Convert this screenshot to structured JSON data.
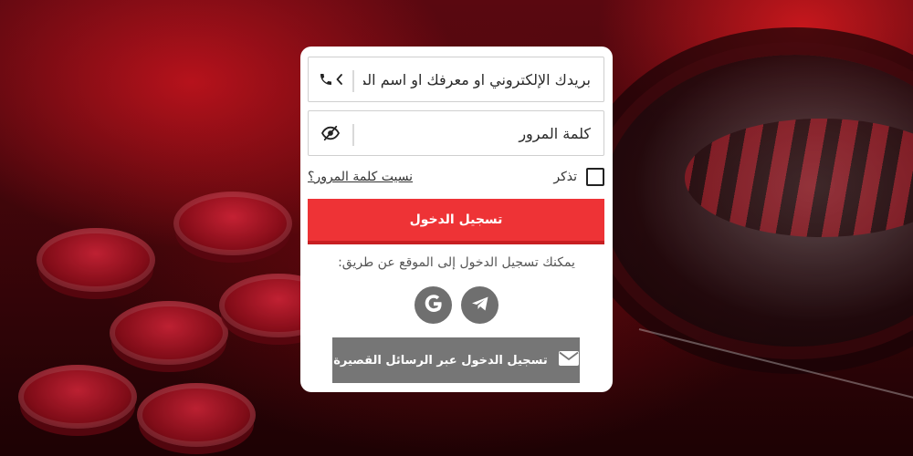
{
  "login_form": {
    "login_field": {
      "placeholder": "بريدك الإلكتروني او معرفك او اسم المستخدم"
    },
    "password_field": {
      "placeholder": "كلمة المرور"
    },
    "remember_label": "تذكر",
    "forgot_password_label": "نسيت كلمة المرور؟",
    "login_button_label": "تسجيل الدخول",
    "alt_login_text": "يمكنك تسجيل الدخول إلى الموقع عن طريق:",
    "social_logins": [
      {
        "name": "google",
        "icon": "google-icon"
      },
      {
        "name": "telegram",
        "icon": "telegram-icon"
      }
    ],
    "sms_button_label": "تسجيل الدخول عبر الرسائل القصيرة"
  },
  "icons": {
    "login_prefix": [
      "chevron-left-icon",
      "phone-icon"
    ],
    "password_toggle": "eye-slash-icon",
    "sms": "envelope-icon"
  },
  "colors": {
    "primary": "#ee3336",
    "primary_border": "#c81f22",
    "secondary": "#767676",
    "social": "#6f6f6f"
  }
}
